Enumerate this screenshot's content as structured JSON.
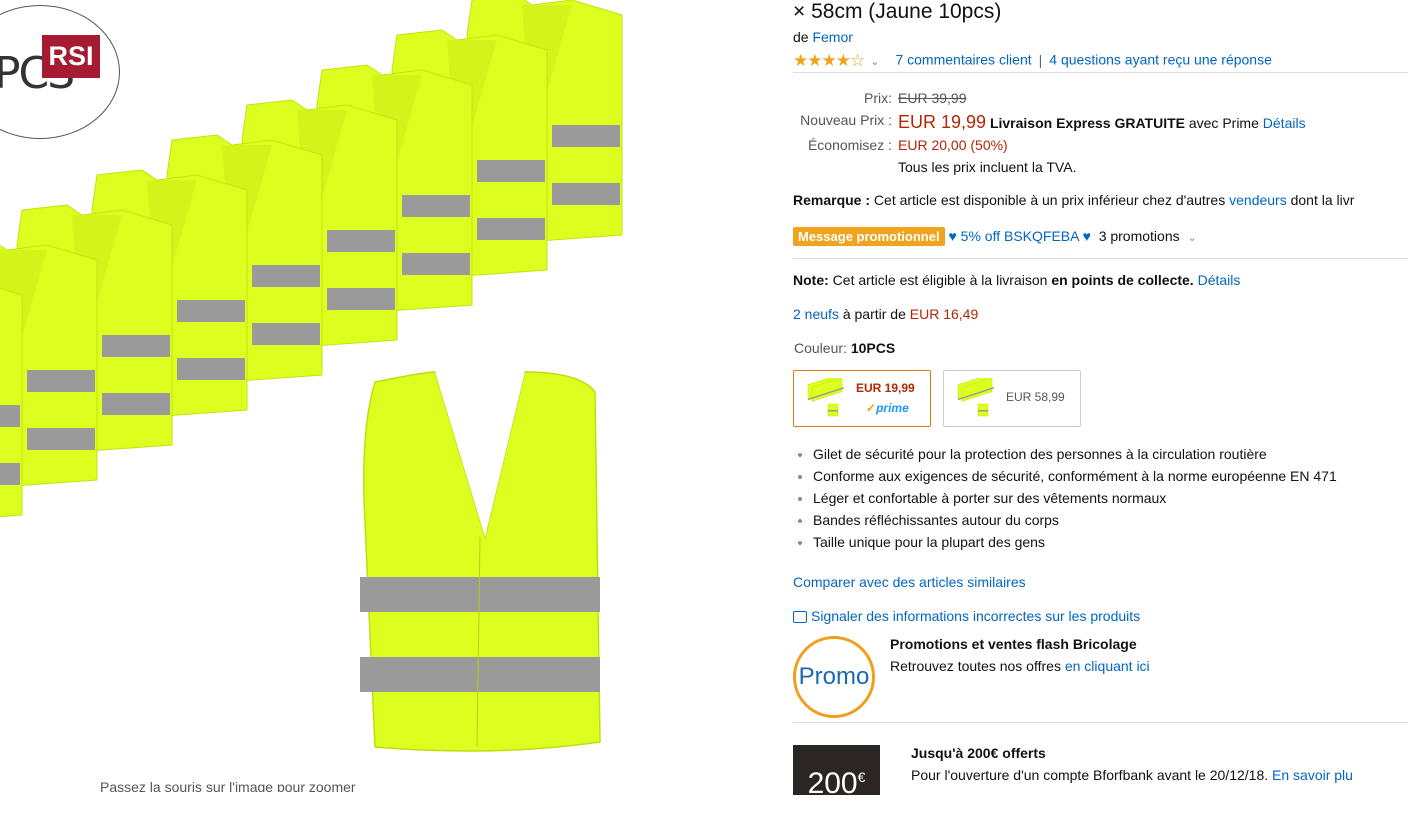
{
  "image_panel": {
    "logo_partial_text": "PCS",
    "rsi_badge": "RSI",
    "zoom_hint": "Passez la souris sur l'image pour zoomer",
    "vest_color": "#dcff1f",
    "reflective_color": "#9a9a9a"
  },
  "product": {
    "title_tail": "× 58cm (Jaune 10pcs)",
    "brand_prefix": "de",
    "brand": "Femor",
    "rating": 4,
    "reviews_link": "7 commentaires client",
    "questions_link": "4 questions ayant reçu une réponse"
  },
  "pricing": {
    "list_label": "Prix:",
    "list_price": "EUR 39,99",
    "new_label": "Nouveau Prix :",
    "new_price": "EUR 19,99",
    "delivery_bold": "Livraison Express GRATUITE",
    "delivery_plain": "avec Prime",
    "details_link": "Détails",
    "save_label": "Économisez :",
    "save_value": "EUR 20,00 (50%)",
    "tax_note": "Tous les prix incluent la TVA."
  },
  "remark": {
    "label": "Remarque :",
    "text": "Cet article est disponible à un prix inférieur chez d'autres",
    "link": "vendeurs",
    "tail": "dont la livr"
  },
  "promotion": {
    "badge": "Message promotionnel",
    "code": "5% off BSKQFEBA",
    "count": "3 promotions"
  },
  "note": {
    "label": "Note:",
    "text": "Cet article est éligible à la livraison",
    "bold": "en points de collecte.",
    "link": "Détails"
  },
  "offers": {
    "link": "2 neufs",
    "text": "à partir de",
    "price": "EUR 16,49"
  },
  "color": {
    "label": "Couleur:",
    "value": "10PCS",
    "swatches": [
      {
        "price": "EUR 19,99",
        "prime": "prime"
      },
      {
        "price": "EUR 58,99"
      }
    ]
  },
  "bullets": [
    "Gilet de sécurité pour la protection des personnes à la circulation routière",
    "Conforme aux exigences de sécurité, conformément à la norme européenne EN 471",
    "Léger et confortable à porter sur des vêtements normaux",
    "Bandes réfléchissantes autour du corps",
    "Taille unique pour la plupart des gens"
  ],
  "links": {
    "compare": "Comparer avec des articles similaires",
    "report": "Signaler des informations incorrectes sur les produits"
  },
  "promo_banner": {
    "circle": "Promo",
    "title": "Promotions et ventes flash Bricolage",
    "text": "Retrouvez toutes nos offres",
    "link": "en cliquant ici"
  },
  "bank_banner": {
    "amount": "200",
    "currency": "€",
    "title": "Jusqu'à 200€ offerts",
    "text": "Pour l'ouverture d'un compte Bforfbank avant le 20/12/18.",
    "link": "En savoir plu"
  }
}
